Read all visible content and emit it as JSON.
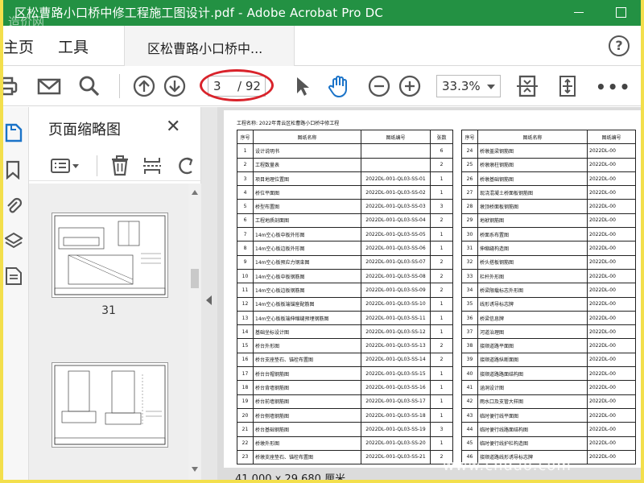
{
  "window": {
    "title": "区松曹路小口桥中修工程施工图设计.pdf - Adobe Acrobat Pro DC",
    "watermark": "造价网"
  },
  "tabs": {
    "home": "主页",
    "tools": "工具",
    "document": "区松曹路小口桥中..."
  },
  "toolbar": {
    "current_page": "3",
    "total_pages": "/ 92",
    "zoom": "33.3%"
  },
  "thumbnail_panel": {
    "title": "页面缩略图",
    "pages": [
      {
        "label": "31"
      },
      {
        "label": ""
      }
    ]
  },
  "document": {
    "project_label": "工程名称: 2022年青云区松曹路小口桥中修工程",
    "headers": [
      "序号",
      "图纸名称",
      "图纸编号",
      "张数",
      "序号",
      "图纸名称",
      "图纸编号"
    ],
    "left_rows": [
      [
        "1",
        "设计说明书",
        "",
        "6"
      ],
      [
        "2",
        "工程数量表",
        "",
        "2"
      ],
      [
        "3",
        "项目地理位置图",
        "2022DL-001-QL03-SS-01",
        "1"
      ],
      [
        "4",
        "桥位平面图",
        "2022DL-001-QL03-SS-02",
        "1"
      ],
      [
        "5",
        "桥型布置图",
        "2022DL-001-QL03-SS-03",
        "3"
      ],
      [
        "6",
        "工程地质剖面图",
        "2022DL-001-QL03-SS-04",
        "2"
      ],
      [
        "7",
        "14m空心板中板外形图",
        "2022DL-001-QL03-SS-05",
        "1"
      ],
      [
        "8",
        "14m空心板边板外形图",
        "2022DL-001-QL03-SS-06",
        "1"
      ],
      [
        "9",
        "14m空心板预应力钢束图",
        "2022DL-001-QL03-SS-07",
        "2"
      ],
      [
        "10",
        "14m空心板中板钢筋图",
        "2022DL-001-QL03-SS-08",
        "2"
      ],
      [
        "11",
        "14m空心板边板钢筋图",
        "2022DL-001-QL03-SS-09",
        "2"
      ],
      [
        "12",
        "14m空心板板端锚座配筋图",
        "2022DL-001-QL03-SS-10",
        "1"
      ],
      [
        "13",
        "14m空心板板端伸缩缝预埋钢筋图",
        "2022DL-001-QL03-SS-11",
        "1"
      ],
      [
        "14",
        "基础坐标设计图",
        "2022DL-001-QL03-SS-12",
        "1"
      ],
      [
        "15",
        "桥台外形图",
        "2022DL-001-QL03-SS-13",
        "2"
      ],
      [
        "16",
        "桥台支座垫石、锚栓布置图",
        "2022DL-001-QL03-SS-14",
        "2"
      ],
      [
        "17",
        "桥台台帽钢筋图",
        "2022DL-001-QL03-SS-15",
        "1"
      ],
      [
        "18",
        "桥台背墙钢筋图",
        "2022DL-001-QL03-SS-16",
        "1"
      ],
      [
        "19",
        "桥台前墙钢筋图",
        "2022DL-001-QL03-SS-17",
        "1"
      ],
      [
        "20",
        "桥台侧墙钢筋图",
        "2022DL-001-QL03-SS-18",
        "1"
      ],
      [
        "21",
        "桥台基础钢筋图",
        "2022DL-001-QL03-SS-19",
        "3"
      ],
      [
        "22",
        "桥墩外形图",
        "2022DL-001-QL03-SS-20",
        "1"
      ],
      [
        "23",
        "桥墩支座垫石、锚栓布置图",
        "2022DL-001-QL03-SS-21",
        "2"
      ]
    ],
    "right_rows": [
      [
        "24",
        "桥墩盖梁钢筋图",
        "2022DL-00"
      ],
      [
        "25",
        "桥墩墩柱钢筋图",
        "2022DL-00"
      ],
      [
        "26",
        "桥墩基础钢筋图",
        "2022DL-00"
      ],
      [
        "27",
        "现浇混凝土桥面板钢筋图",
        "2022DL-00"
      ],
      [
        "28",
        "墩顶桥面板钢筋图",
        "2022DL-00"
      ],
      [
        "29",
        "地袱钢筋图",
        "2022DL-00"
      ],
      [
        "30",
        "桥面系布置图",
        "2022DL-00"
      ],
      [
        "31",
        "伸缩缝构造图",
        "2022DL-00"
      ],
      [
        "32",
        "桥头搭板钢筋图",
        "2022DL-00"
      ],
      [
        "33",
        "栏杆外形图",
        "2022DL-00"
      ],
      [
        "34",
        "桥梁限载标志外形图",
        "2022DL-00"
      ],
      [
        "35",
        "线形诱导标志牌",
        "2022DL-00"
      ],
      [
        "36",
        "桥梁信息牌",
        "2022DL-00"
      ],
      [
        "37",
        "河道治理图",
        "2022DL-00"
      ],
      [
        "38",
        "接顺道路平面图",
        "2022DL-00"
      ],
      [
        "39",
        "接顺道路纵断面图",
        "2022DL-00"
      ],
      [
        "40",
        "接顺道路路面结构图",
        "2022DL-00"
      ],
      [
        "41",
        "涵洞设计图",
        "2022DL-00"
      ],
      [
        "42",
        "雨水口及支管大样图",
        "2022DL-00"
      ],
      [
        "43",
        "临时便行线平面图",
        "2022DL-00"
      ],
      [
        "44",
        "临时便行线路面结构图",
        "2022DL-00"
      ],
      [
        "45",
        "临时便行线护栏构造图",
        "2022DL-00"
      ],
      [
        "46",
        "接顺道路线形诱导标志牌",
        "2022DL-00"
      ]
    ]
  },
  "statusbar": {
    "page_size": "41.000 x 29.680 厘米"
  },
  "site_watermark": "www.cndao.com",
  "colors": {
    "titlebar": "#239143",
    "page_highlight": "#d9232b",
    "background_frame": "#f3df4c"
  }
}
